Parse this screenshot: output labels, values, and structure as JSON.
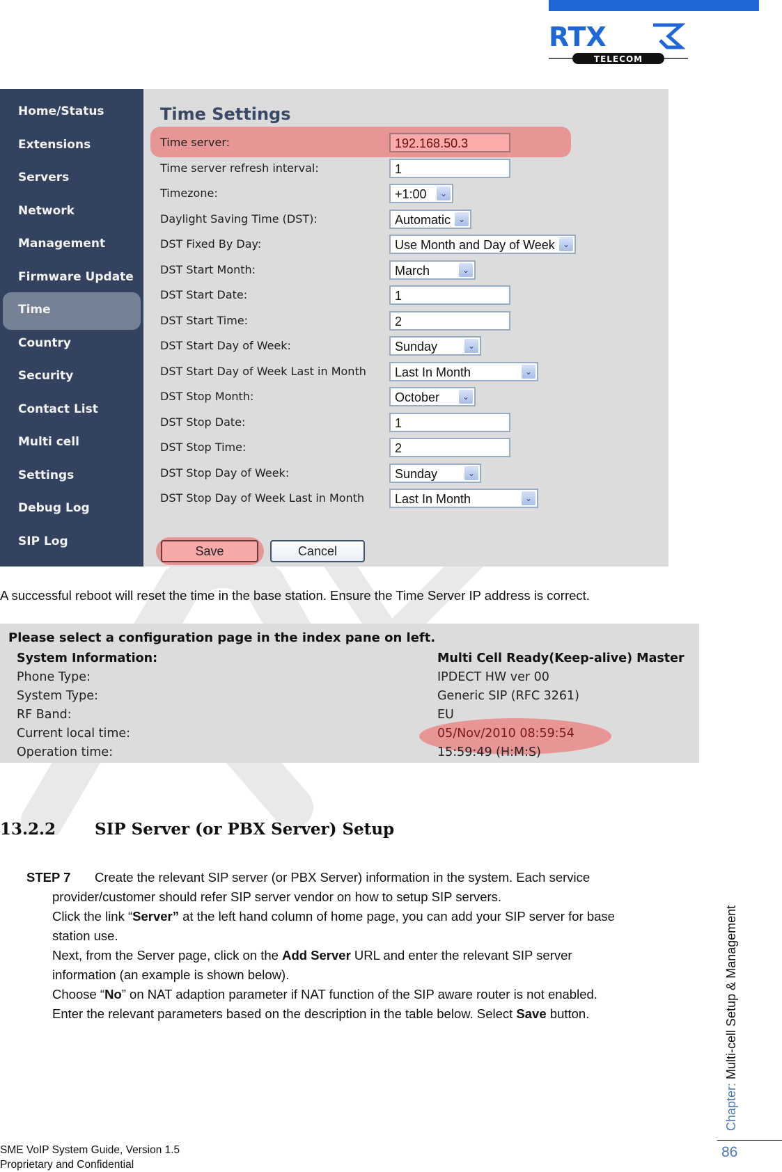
{
  "brand": {
    "name": "RTX",
    "tagline": "TELECOM",
    "color": "#1f66d6"
  },
  "time_settings_screen": {
    "title": "Time Settings",
    "sidebar": {
      "items": [
        {
          "label": "Home/Status",
          "active": false
        },
        {
          "label": "Extensions",
          "active": false
        },
        {
          "label": "Servers",
          "active": false
        },
        {
          "label": "Network",
          "active": false
        },
        {
          "label": "Management",
          "active": false
        },
        {
          "label": "Firmware Update",
          "active": false
        },
        {
          "label": "Time",
          "active": true
        },
        {
          "label": "Country",
          "active": false
        },
        {
          "label": "Security",
          "active": false
        },
        {
          "label": "Contact List",
          "active": false
        },
        {
          "label": "Multi cell",
          "active": false
        },
        {
          "label": "Settings",
          "active": false
        },
        {
          "label": "Debug Log",
          "active": false
        },
        {
          "label": "SIP Log",
          "active": false
        }
      ]
    },
    "fields": [
      {
        "label": "Time server:",
        "type": "input",
        "value": "192.168.50.3",
        "highlighted": true
      },
      {
        "label": "Time server refresh interval:",
        "type": "input",
        "value": "1"
      },
      {
        "label": "Timezone:",
        "type": "select",
        "value": "+1:00"
      },
      {
        "label": "Daylight Saving Time (DST):",
        "type": "select",
        "value": "Automatic"
      },
      {
        "label": "DST Fixed By Day:",
        "type": "select",
        "value": "Use Month and Day of Week"
      },
      {
        "label": "DST Start Month:",
        "type": "select",
        "value": "March"
      },
      {
        "label": "DST Start Date:",
        "type": "input",
        "value": "1"
      },
      {
        "label": "DST Start Time:",
        "type": "input",
        "value": "2"
      },
      {
        "label": "DST Start Day of Week:",
        "type": "select",
        "value": "Sunday"
      },
      {
        "label": "DST Start Day of Week Last in Month",
        "type": "select",
        "value": "Last In Month"
      },
      {
        "label": "DST Stop Month:",
        "type": "select",
        "value": "October"
      },
      {
        "label": "DST Stop Date:",
        "type": "input",
        "value": "1"
      },
      {
        "label": "DST Stop Time:",
        "type": "input",
        "value": "2"
      },
      {
        "label": "DST Stop Day of Week:",
        "type": "select",
        "value": "Sunday"
      },
      {
        "label": "DST Stop Day of Week Last in Month",
        "type": "select",
        "value": "Last In Month"
      }
    ],
    "save_label": "Save",
    "cancel_label": "Cancel",
    "highlight_color": "#e79595"
  },
  "caption": "A successful reboot will reset the time in the base station. Ensure the Time Server IP address is correct.",
  "status_screen": {
    "title": "Please select a configuration page in the index pane on left.",
    "rows": [
      {
        "label": "System Information:",
        "value": "Multi Cell Ready(Keep-alive) Master",
        "bold": true
      },
      {
        "label": "Phone Type:",
        "value": "IPDECT HW ver 00"
      },
      {
        "label": "System Type:",
        "value": "Generic SIP (RFC 3261)"
      },
      {
        "label": "RF Band:",
        "value": "EU"
      },
      {
        "label": "Current local time:",
        "value": "05/Nov/2010 08:59:54",
        "highlighted": true
      },
      {
        "label": "Operation time:",
        "value": "15:59:49 (H:M:S)"
      }
    ]
  },
  "section": {
    "number": "13.2.2",
    "title": "SIP Server (or PBX Server) Setup"
  },
  "step": {
    "label": "STEP 7",
    "lines": [
      {
        "pre": "Create the relevant SIP server (or PBX Server) information in the system. Each service",
        "bold": "",
        "post": ""
      },
      {
        "pre": "provider/customer should refer SIP server vendor on how to setup SIP servers.",
        "bold": "",
        "post": ""
      },
      {
        "pre": "Click the link “",
        "bold": "Server”",
        "post": " at the left hand column of home page, you can add your SIP server for base"
      },
      {
        "pre": "station use.",
        "bold": "",
        "post": ""
      },
      {
        "pre": "Next, from the Server page, click on the ",
        "bold": "Add Server",
        "post": " URL and enter the relevant SIP server"
      },
      {
        "pre": "information (an example is shown below).",
        "bold": "",
        "post": ""
      },
      {
        "pre": "Choose  “",
        "bold": "No",
        "post": "” on NAT adaption parameter if NAT function of the SIP aware router is not enabled."
      },
      {
        "pre": "Enter the relevant parameters based on the description in the table below. Select ",
        "bold": "Save",
        "post": " button."
      }
    ]
  },
  "footer": {
    "doc_title": "SME VoIP System Guide, Version 1.5",
    "confidentiality": "Proprietary and Confidential",
    "page_number": "86",
    "chapter_label": "Chapter:",
    "chapter_name": " Multi-cell Setup & Management"
  }
}
